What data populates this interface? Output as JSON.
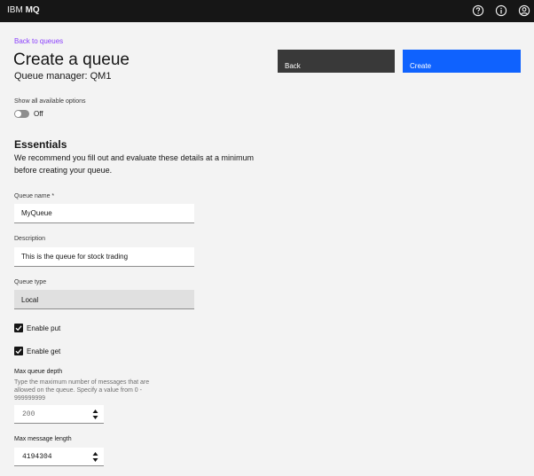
{
  "header": {
    "brand_plain": "IBM ",
    "brand_bold": "MQ",
    "icons": [
      "help-icon",
      "info-icon",
      "user-icon"
    ]
  },
  "page": {
    "back_link": "Back to queues",
    "title": "Create a queue",
    "queue_manager": "Queue manager: QM1",
    "back_button": "Back",
    "create_button": "Create"
  },
  "options_toggle": {
    "label": "Show all available options",
    "state": "Off",
    "on": false
  },
  "essentials": {
    "title": "Essentials",
    "description": "We recommend you fill out and evaluate these details at a minimum before creating your queue."
  },
  "form": {
    "queue_name": {
      "label": "Queue name *",
      "value": "MyQueue"
    },
    "description": {
      "label": "Description",
      "value": "This is the queue for stock trading"
    },
    "queue_type": {
      "label": "Queue type",
      "value": "Local"
    },
    "enable_put": {
      "label": "Enable put",
      "checked": true
    },
    "enable_get": {
      "label": "Enable get",
      "checked": true
    },
    "max_queue_depth": {
      "label": "Max queue depth",
      "helper": "Type the maximum number of messages that are allowed on the queue. Specify a value from 0 - 999999999",
      "value": "200"
    },
    "max_message_length": {
      "label": "Max message length",
      "value": "4194304"
    }
  },
  "colors": {
    "header_bg": "#161616",
    "link": "#8a3ffc",
    "primary": "#0f62fe",
    "secondary": "#393939"
  }
}
